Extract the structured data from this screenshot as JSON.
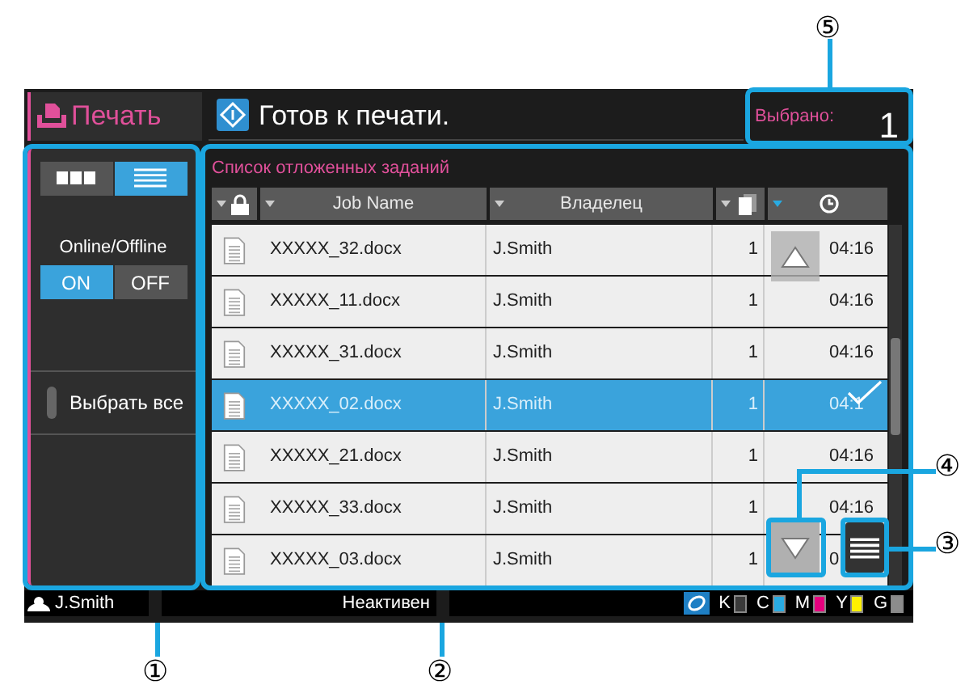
{
  "app_tab": {
    "label": "Печать"
  },
  "status": {
    "text": "Готов к печати."
  },
  "selected_count": {
    "label": "Выбрано:",
    "value": "1"
  },
  "view_toggle": [
    {
      "kind": "grid",
      "selected": false
    },
    {
      "kind": "list",
      "selected": true
    }
  ],
  "online": {
    "label": "Online/Offline",
    "options": [
      {
        "label": "ON",
        "selected": true
      },
      {
        "label": "OFF",
        "selected": false
      }
    ]
  },
  "select_all": {
    "label": "Выбрать все",
    "checked": false
  },
  "job_list": {
    "title": "Список отложенных заданий",
    "columns": [
      {
        "kind": "lock"
      },
      {
        "kind": "text",
        "label": "Job Name"
      },
      {
        "kind": "text",
        "label": "Владелец"
      },
      {
        "kind": "copies"
      },
      {
        "kind": "time",
        "sorted": true
      }
    ],
    "rows": [
      {
        "name": "XXXXX_32.docx",
        "owner": "J.Smith",
        "copies": "1",
        "time": "04:16",
        "selected": false
      },
      {
        "name": "XXXXX_11.docx",
        "owner": "J.Smith",
        "copies": "1",
        "time": "04:16",
        "selected": false
      },
      {
        "name": "XXXXX_31.docx",
        "owner": "J.Smith",
        "copies": "1",
        "time": "04:16",
        "selected": false
      },
      {
        "name": "XXXXX_02.docx",
        "owner": "J.Smith",
        "copies": "1",
        "time": "04:1",
        "selected": true
      },
      {
        "name": "XXXXX_21.docx",
        "owner": "J.Smith",
        "copies": "1",
        "time": "04:16",
        "selected": false
      },
      {
        "name": "XXXXX_33.docx",
        "owner": "J.Smith",
        "copies": "1",
        "time": "04:16",
        "selected": false
      },
      {
        "name": "XXXXX_03.docx",
        "owner": "J.Smith",
        "copies": "1",
        "time": "0",
        "selected": false
      }
    ]
  },
  "status_bar": {
    "user": "J.Smith",
    "state": "Неактивен",
    "inks": [
      {
        "label": "K",
        "color": "#3a3a3a"
      },
      {
        "label": "C",
        "color": "#29abe2"
      },
      {
        "label": "M",
        "color": "#e6007e"
      },
      {
        "label": "Y",
        "color": "#fff100"
      },
      {
        "label": "G",
        "color": "#8c8c8c"
      }
    ]
  },
  "callouts": [
    "①",
    "②",
    "③",
    "④",
    "⑤"
  ]
}
